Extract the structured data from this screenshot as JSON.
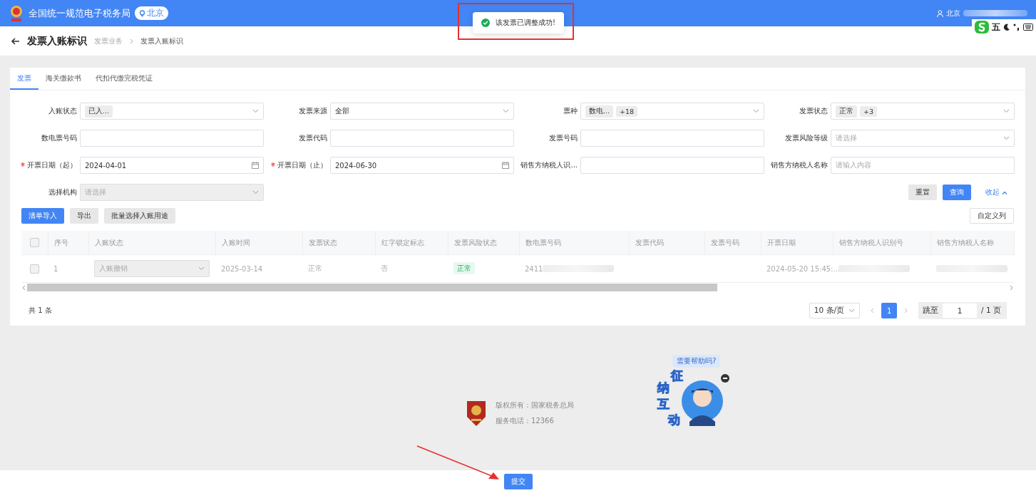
{
  "topbar": {
    "title": "全国统一规范电子税务局",
    "location": "北京",
    "user": "北京"
  },
  "toast": {
    "message": "该发票已调整成功!"
  },
  "ime": {
    "mode": "五"
  },
  "page_header": {
    "title": "发票入账标识",
    "breadcrumbs": [
      {
        "label": "发票业务",
        "current": false
      },
      {
        "label": "发票入账标识",
        "current": true
      }
    ]
  },
  "tabs": [
    {
      "label": "发票",
      "selected": true
    },
    {
      "label": "海关缴款书",
      "selected": false
    },
    {
      "label": "代扣代缴完税凭证",
      "selected": false
    }
  ],
  "filters": [
    {
      "label": "入账状态",
      "required": false,
      "kind": "select",
      "tags": [
        "已入..."
      ]
    },
    {
      "label": "发票来源",
      "required": false,
      "kind": "select",
      "value": "全部"
    },
    {
      "label": "票种",
      "required": false,
      "kind": "select",
      "tags": [
        "数电...",
        "+18"
      ]
    },
    {
      "label": "发票状态",
      "required": false,
      "kind": "select",
      "tags": [
        "正常",
        "+3"
      ]
    },
    {
      "label": "数电票号码",
      "required": false,
      "kind": "input"
    },
    {
      "label": "发票代码",
      "required": false,
      "kind": "input"
    },
    {
      "label": "发票号码",
      "required": false,
      "kind": "input"
    },
    {
      "label": "发票风险等级",
      "required": false,
      "kind": "select",
      "placeholder": "请选择"
    },
    {
      "label": "开票日期（起）",
      "required": true,
      "kind": "date",
      "value": "2024-04-01"
    },
    {
      "label": "开票日期（止）",
      "required": true,
      "kind": "date",
      "value": "2024-06-30"
    },
    {
      "label": "销售方纳税人识...",
      "required": false,
      "kind": "input"
    },
    {
      "label": "销售方纳税人名称",
      "required": false,
      "kind": "input",
      "placeholder": "请输入内容"
    },
    {
      "label": "选择机构",
      "required": false,
      "kind": "select",
      "placeholder": "请选择",
      "disabled": true
    }
  ],
  "filter_actions": {
    "reset": "重置",
    "query": "查询",
    "collapse": "收起"
  },
  "toolbar": [
    {
      "label": "清单导入",
      "kind": "primary"
    },
    {
      "label": "导出",
      "kind": "default"
    },
    {
      "label": "批量选择入账用途",
      "kind": "default"
    }
  ],
  "customize_columns": "自定义列",
  "table": {
    "select_all": {
      "checked": false
    },
    "columns": [
      "序号",
      "入账状态",
      "入账时间",
      "发票状态",
      "红字锁定标志",
      "发票风险状态",
      "数电票号码",
      "发票代码",
      "发票号码",
      "开票日期",
      "销售方纳税人识别号",
      "销售方纳税人名称"
    ],
    "rows": [
      {
        "checked": false,
        "cells": [
          {
            "kind": "text",
            "text": "1"
          },
          {
            "kind": "select",
            "text": "入账撤销"
          },
          {
            "kind": "text",
            "text": "2025-03-14"
          },
          {
            "kind": "text",
            "text": "正常"
          },
          {
            "kind": "text",
            "text": "否"
          },
          {
            "kind": "tag",
            "text": "正常"
          },
          {
            "kind": "redacted",
            "text": "2411"
          },
          {
            "kind": "text"
          },
          {
            "kind": "text"
          },
          {
            "kind": "text",
            "text": "2024-05-20 15:45:..."
          },
          {
            "kind": "redacted"
          },
          {
            "kind": "redacted"
          }
        ]
      }
    ]
  },
  "pagination": {
    "total": "共 1 条",
    "page_size": "10 条/页",
    "pages": [
      {
        "label": "1",
        "selected": true
      }
    ],
    "jump_label": "跳至",
    "jump_value": "1",
    "page_count": "/ 1 页"
  },
  "footer": {
    "copyright": "版权所有：国家税务总局",
    "phone": "服务电话：12366"
  },
  "assistant": {
    "bubble": "需要帮助吗?",
    "characters": [
      "征",
      "纳",
      "互",
      "动"
    ]
  },
  "submit": "提交"
}
